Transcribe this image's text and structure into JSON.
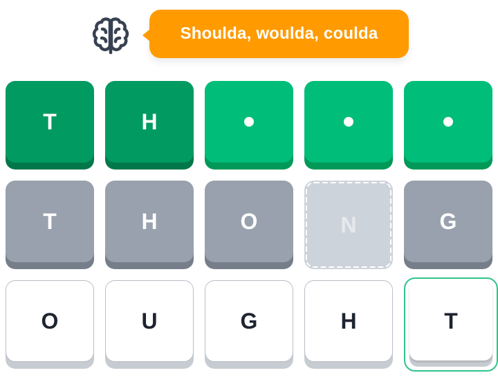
{
  "hint": {
    "icon": "brain-icon",
    "message": "Shoulda, woulda, coulda",
    "bubble_color": "#ff9b00"
  },
  "board": {
    "solved_row": [
      {
        "letter": "T",
        "style": "revealed"
      },
      {
        "letter": "H",
        "style": "revealed"
      },
      {
        "letter": "",
        "style": "hidden"
      },
      {
        "letter": "",
        "style": "hidden"
      },
      {
        "letter": "",
        "style": "hidden"
      }
    ],
    "guess_row": [
      {
        "letter": "T"
      },
      {
        "letter": "H"
      },
      {
        "letter": "O"
      },
      {
        "letter": "N",
        "style": "dashed-slot"
      },
      {
        "letter": "G"
      }
    ],
    "letter_row": [
      {
        "letter": "O"
      },
      {
        "letter": "U"
      },
      {
        "letter": "G"
      },
      {
        "letter": "H"
      },
      {
        "letter": "T",
        "selected": true
      }
    ]
  },
  "colors": {
    "green_dark": "#019a61",
    "green_light": "#00bd79",
    "grey": "#98a1ad",
    "selected_outline": "#2fc38b"
  }
}
